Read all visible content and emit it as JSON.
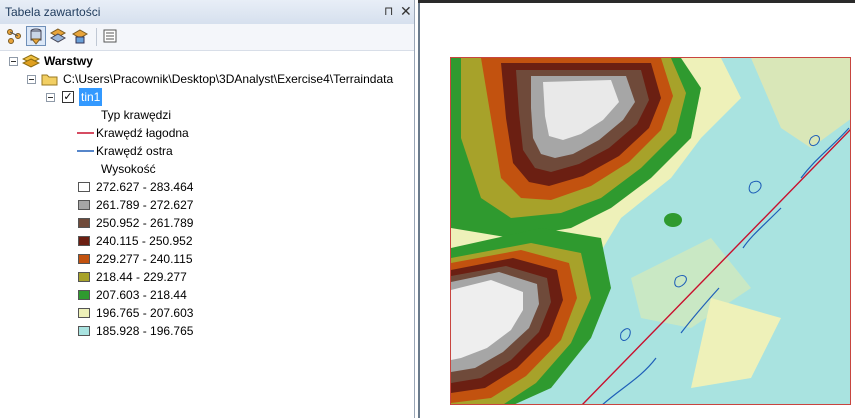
{
  "panel": {
    "title": "Tabela zawartości",
    "pin_glyph": "⊓",
    "close_glyph": "✕"
  },
  "toolbar": {
    "buttons": [
      {
        "icon": "list-by-drawing-order-icon"
      },
      {
        "icon": "list-by-source-icon"
      },
      {
        "icon": "list-by-visibility-icon"
      },
      {
        "icon": "list-by-selection-icon"
      },
      {
        "icon": "options-icon"
      }
    ]
  },
  "tree": {
    "root_label": "Warstwy",
    "folder_label": "C:\\Users\\Pracownik\\Desktop\\3DAnalyst\\Exercise4\\Terraindata",
    "layer_label": "tin1",
    "layer_checked": "✓",
    "edge_heading": "Typ krawędzi",
    "edges": [
      {
        "label": "Krawędź łagodna",
        "color": "#c8102e"
      },
      {
        "label": "Krawędź ostra",
        "color": "#1f5fb8"
      }
    ],
    "elevation_heading": "Wysokość",
    "classes": [
      {
        "label": "272.627 - 283.464",
        "color": "#ffffff"
      },
      {
        "label": "261.789 - 272.627",
        "color": "#a6a6a6"
      },
      {
        "label": "250.952 - 261.789",
        "color": "#6f4a3a"
      },
      {
        "label": "240.115 - 250.952",
        "color": "#6b1f12"
      },
      {
        "label": "229.277 - 240.115",
        "color": "#c2520f"
      },
      {
        "label": "218.44 - 229.277",
        "color": "#a7a22a"
      },
      {
        "label": "207.603 - 218.44",
        "color": "#2f9a2f"
      },
      {
        "label": "196.765 - 207.603",
        "color": "#eef1b9"
      },
      {
        "label": "185.928 - 196.765",
        "color": "#a9e3e0"
      }
    ]
  }
}
